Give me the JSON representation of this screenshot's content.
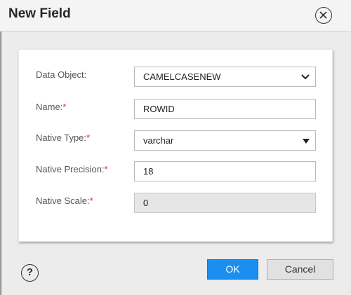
{
  "dialog": {
    "title": "New Field",
    "close_icon": "close-circle-icon",
    "help_label": "?"
  },
  "form": {
    "data_object": {
      "label": "Data Object:",
      "value": "CAMELCASENEW",
      "required": false
    },
    "name": {
      "label": "Name:",
      "value": "ROWID",
      "required": true
    },
    "native_type": {
      "label": "Native Type:",
      "value": "varchar",
      "required": true
    },
    "native_precision": {
      "label": "Native Precision:",
      "value": "18",
      "required": true
    },
    "native_scale": {
      "label": "Native Scale:",
      "value": "0",
      "required": true,
      "disabled": true
    },
    "required_mark": "*"
  },
  "buttons": {
    "ok": "OK",
    "cancel": "Cancel"
  },
  "colors": {
    "accent": "#1a8ff0",
    "required": "#e0282e"
  }
}
